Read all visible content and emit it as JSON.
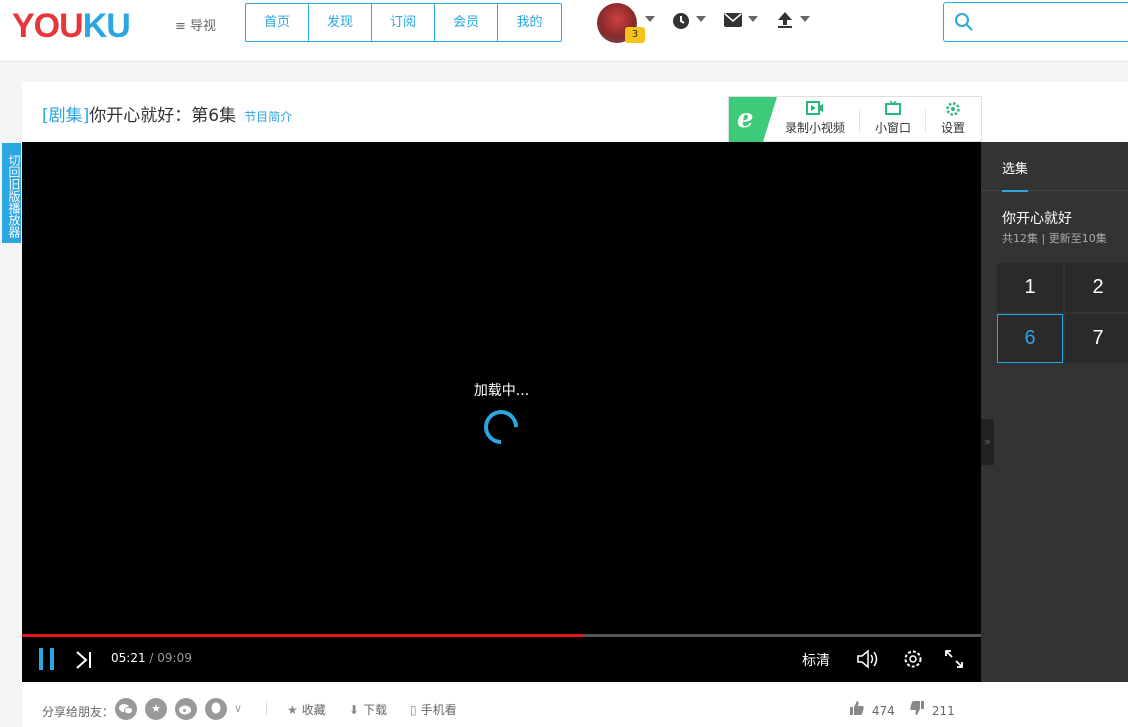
{
  "header": {
    "logo_part1": "YOU",
    "logo_part2": "KU",
    "guide_label": "导视",
    "nav": [
      "首页",
      "发现",
      "订阅",
      "会员",
      "我的"
    ],
    "user_level": "3"
  },
  "video": {
    "category": "[剧集]",
    "title": "你开心就好：第6集",
    "intro_link": "节目简介",
    "tools": {
      "record": "录制小视频",
      "mini": "小窗口",
      "settings": "设置"
    },
    "switch_old": "切回旧版播放器"
  },
  "player": {
    "loading": "加载中...",
    "current_time": "05:21",
    "total_time": "/ 09:09",
    "progress_fraction": 0.585,
    "quality": "标清"
  },
  "episodes": {
    "tab": "选集",
    "show_title": "你开心就好",
    "meta": "共12集 | 更新至10集",
    "numbers": [
      "1",
      "2",
      "6",
      "7"
    ],
    "active": "6"
  },
  "bottom": {
    "share_label": "分享给朋友：",
    "collect": "收藏",
    "download": "下载",
    "mobile": "手机看",
    "likes": "474",
    "dislikes": "211"
  },
  "colors": {
    "accent": "#2aa6e0",
    "progress": "#e4151b",
    "tool_green": "#3dca7a"
  }
}
